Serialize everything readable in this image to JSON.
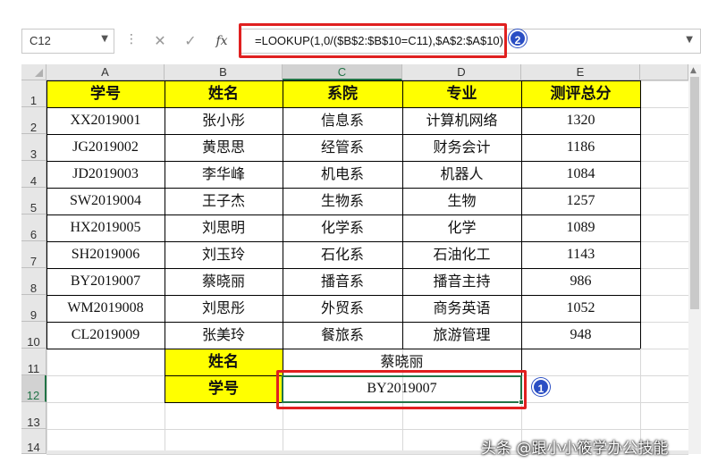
{
  "formula_bar": {
    "name_box": "C12",
    "cancel_icon": "✕",
    "enter_icon": "✓",
    "fx_label": "fx",
    "formula": "=LOOKUP(1,0/($B$2:$B$10=C11),$A$2:$A$10)"
  },
  "annotations": {
    "badge_1": "1",
    "badge_2": "2",
    "highlight_color": "#e02020",
    "badge_color": "#2a4ec4"
  },
  "columns": [
    "A",
    "B",
    "C",
    "D",
    "E"
  ],
  "rows": [
    "1",
    "2",
    "3",
    "4",
    "5",
    "6",
    "7",
    "8",
    "9",
    "10",
    "11",
    "12",
    "13",
    "14"
  ],
  "table": {
    "headers": [
      "学号",
      "姓名",
      "系院",
      "专业",
      "测评总分"
    ],
    "records": [
      [
        "XX2019001",
        "张小彤",
        "信息系",
        "计算机网络",
        "1320"
      ],
      [
        "JG2019002",
        "黄思思",
        "经管系",
        "财务会计",
        "1186"
      ],
      [
        "JD2019003",
        "李华峰",
        "机电系",
        "机器人",
        "1084"
      ],
      [
        "SW2019004",
        "王子杰",
        "生物系",
        "生物",
        "1257"
      ],
      [
        "HX2019005",
        "刘思明",
        "化学系",
        "化学",
        "1089"
      ],
      [
        "SH2019006",
        "刘玉玲",
        "石化系",
        "石油化工",
        "1143"
      ],
      [
        "BY2019007",
        "蔡晓丽",
        "播音系",
        "播音主持",
        "986"
      ],
      [
        "WM2019008",
        "刘思彤",
        "外贸系",
        "商务英语",
        "1052"
      ],
      [
        "CL2019009",
        "张美玲",
        "餐旅系",
        "旅游管理",
        "948"
      ]
    ]
  },
  "lookup": {
    "name_label": "姓名",
    "name_value": "蔡晓丽",
    "id_label": "学号",
    "id_value": "BY2019007"
  },
  "watermark": "头条 @跟小小筱学办公技能",
  "colors": {
    "header_fill": "#ffff00",
    "selection": "#217346"
  }
}
